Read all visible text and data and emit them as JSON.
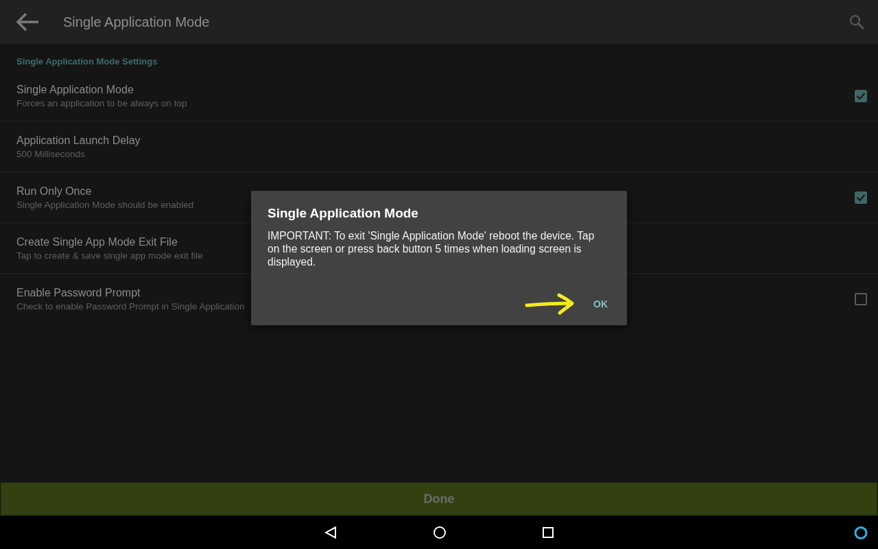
{
  "app_bar": {
    "title": "Single Application Mode"
  },
  "section": {
    "title": "Single Application Mode Settings"
  },
  "settings": [
    {
      "kind": "checkbox",
      "title": "Single Application Mode",
      "summary": "Forces an application to be always on top",
      "checked": true
    },
    {
      "kind": "plain",
      "title": "Application Launch Delay",
      "summary": "500 Milliseconds"
    },
    {
      "kind": "checkbox",
      "title": "Run Only Once",
      "summary": "Single Application Mode should be enabled",
      "checked": true
    },
    {
      "kind": "plain",
      "title": "Create Single App Mode Exit File",
      "summary": "Tap to create & save single app mode exit file"
    },
    {
      "kind": "checkbox",
      "title": "Enable Password Prompt",
      "summary": "Check to enable Password Prompt in Single Application",
      "checked": false
    }
  ],
  "dialog": {
    "title": "Single Application Mode",
    "message": "IMPORTANT: To exit 'Single Application Mode' reboot the device. Tap on the screen or press back button 5 times when loading screen is displayed.",
    "button": "OK"
  },
  "done_button": {
    "label": "Done"
  }
}
